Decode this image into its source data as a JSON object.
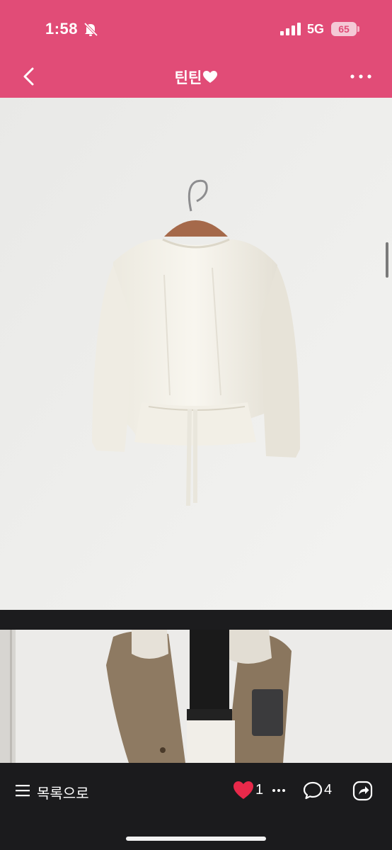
{
  "status_bar": {
    "time": "1:58",
    "network": "5G",
    "battery": "65"
  },
  "header": {
    "title": "틴틴"
  },
  "bottom_bar": {
    "list_label": "목록으로",
    "like_count": "1",
    "comment_count": "4"
  },
  "colors": {
    "header_bg": "#e14c77",
    "heart": "#e8294a",
    "bottom_bg": "#1b1b1d"
  },
  "icons": [
    "bell-off-icon",
    "signal-icon",
    "battery-icon",
    "back-icon",
    "heart-icon",
    "more-icon",
    "list-icon",
    "like-heart-icon",
    "dots-icon",
    "comment-icon",
    "share-icon"
  ]
}
